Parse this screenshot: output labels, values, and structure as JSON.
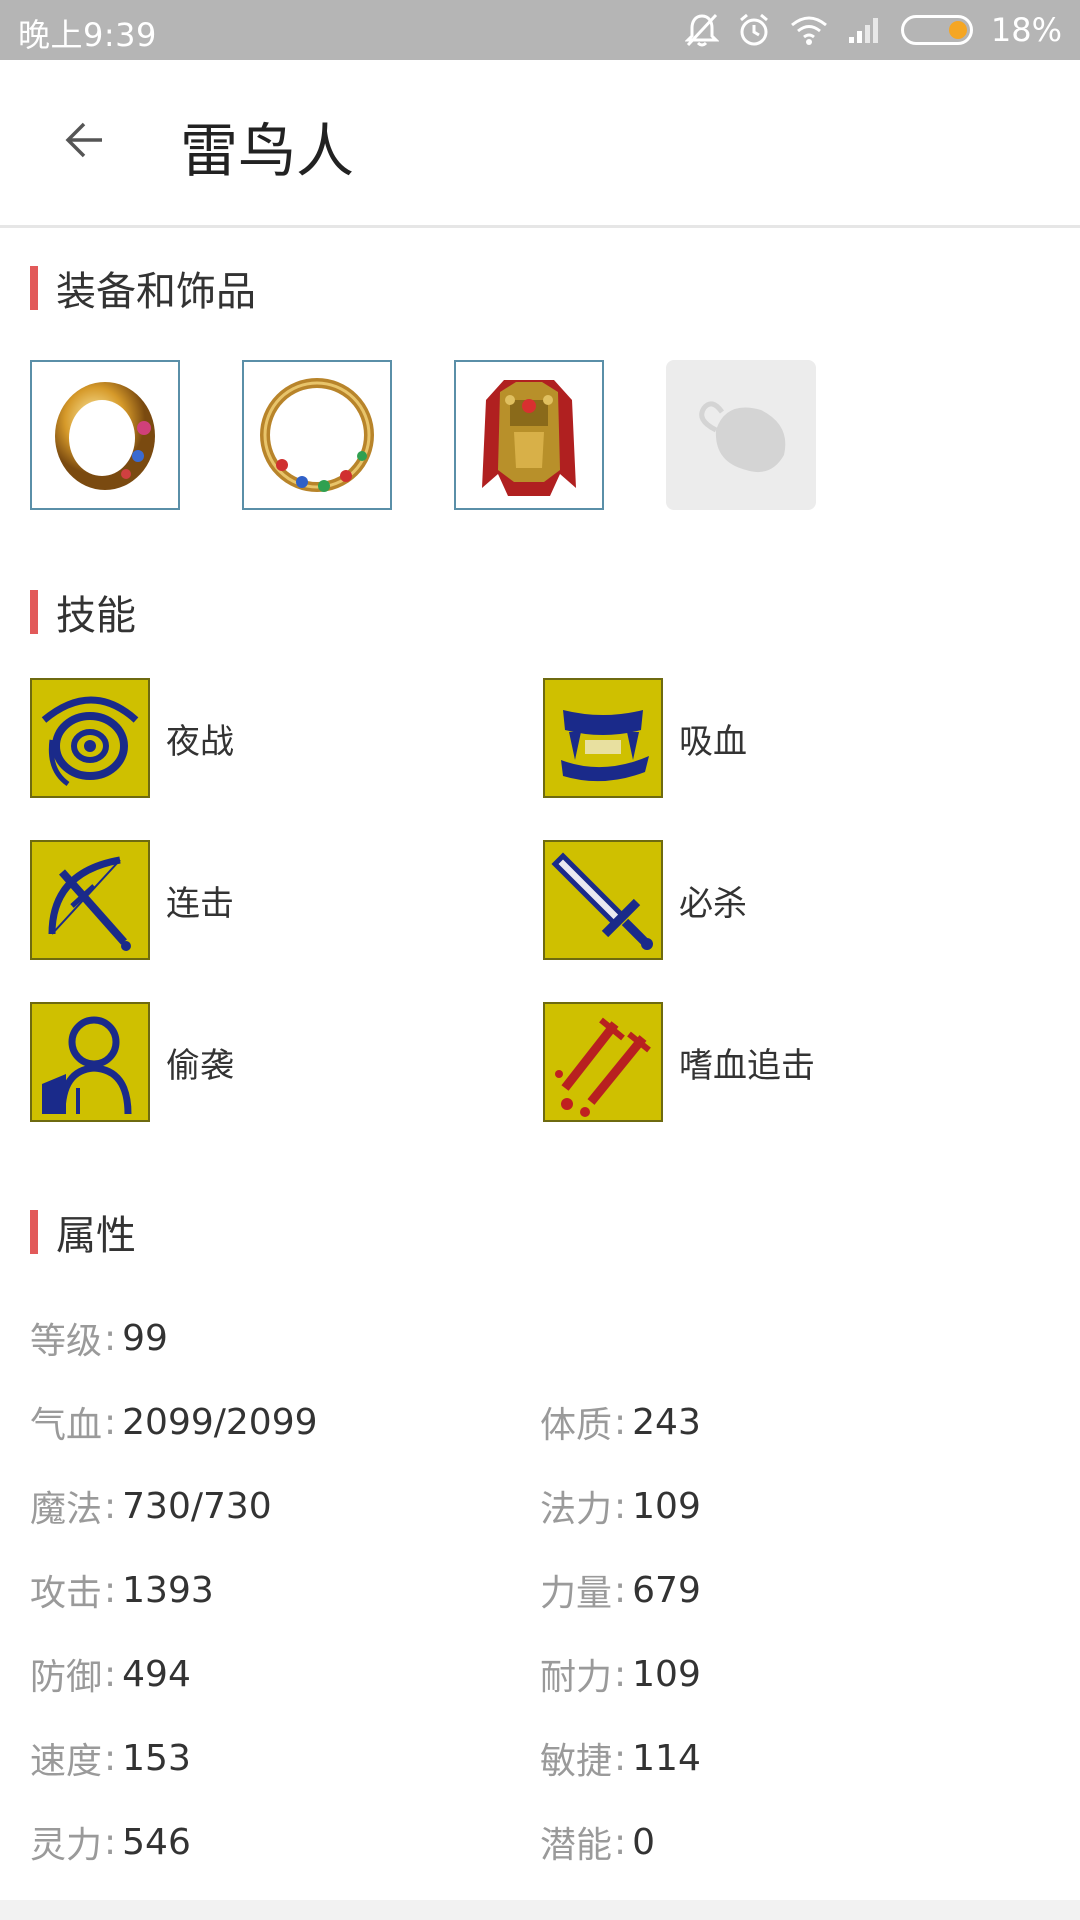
{
  "status_bar": {
    "time": "晚上9:39",
    "battery_percent": "18%",
    "icons": [
      "bell-off-icon",
      "alarm-icon",
      "wifi-icon",
      "signal-icon",
      "battery-icon"
    ]
  },
  "header": {
    "title": "雷鸟人",
    "back_icon": "arrow-left-icon"
  },
  "sections": {
    "equipment": "装备和饰品",
    "skills": "技能",
    "attributes": "属性"
  },
  "equipment": [
    {
      "name": "gold-ring",
      "icon": "ring-icon"
    },
    {
      "name": "jeweled-ring",
      "icon": "ring-icon"
    },
    {
      "name": "golden-armor",
      "icon": "armor-icon"
    },
    {
      "name": "empty-slot",
      "icon": "placeholder-icon"
    }
  ],
  "skills": [
    {
      "label": "夜战",
      "icon": "eye-icon"
    },
    {
      "label": "吸血",
      "icon": "fangs-icon"
    },
    {
      "label": "连击",
      "icon": "bow-sword-icon"
    },
    {
      "label": "必杀",
      "icon": "sword-icon"
    },
    {
      "label": "偷袭",
      "icon": "sneak-icon"
    },
    {
      "label": "嗜血追击",
      "icon": "bloody-swords-icon"
    }
  ],
  "attributes": [
    [
      {
        "key": "等级",
        "value": "99"
      },
      null
    ],
    [
      {
        "key": "气血",
        "value": "2099/2099"
      },
      {
        "key": "体质",
        "value": "243"
      }
    ],
    [
      {
        "key": "魔法",
        "value": "730/730"
      },
      {
        "key": "法力",
        "value": "109"
      }
    ],
    [
      {
        "key": "攻击",
        "value": "1393"
      },
      {
        "key": "力量",
        "value": "679"
      }
    ],
    [
      {
        "key": "防御",
        "value": "494"
      },
      {
        "key": "耐力",
        "value": "109"
      }
    ],
    [
      {
        "key": "速度",
        "value": "153"
      },
      {
        "key": "敏捷",
        "value": "114"
      }
    ],
    [
      {
        "key": "灵力",
        "value": "546"
      },
      {
        "key": "潜能",
        "value": "0"
      }
    ]
  ],
  "attribute_separator": ":",
  "colors": {
    "accent": "#e25a5a",
    "status_bar": "#b5b5b5",
    "skill_bg": "#c8b800",
    "skill_ink": "#1a2a8a"
  }
}
